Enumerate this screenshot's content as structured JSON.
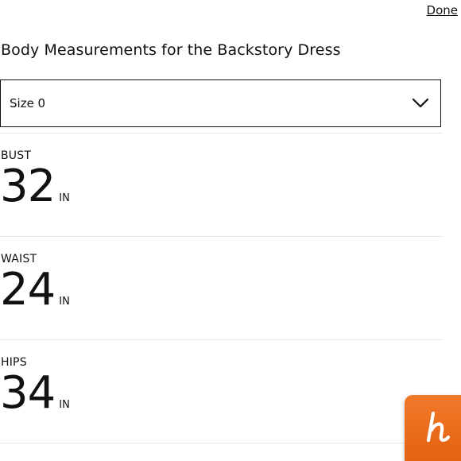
{
  "header": {
    "done_label": "Done",
    "title": "Body Measurements for the Backstory Dress"
  },
  "size_select": {
    "selected": "Size 0",
    "icon": "chevron-down-icon"
  },
  "measurements": [
    {
      "label": "BUST",
      "value": "32",
      "unit": "IN"
    },
    {
      "label": "WAIST",
      "value": "24",
      "unit": "IN"
    },
    {
      "label": "HIPS",
      "value": "34",
      "unit": "IN"
    }
  ],
  "extension_button": {
    "icon": "honey-h-icon",
    "color": "#e8691a"
  }
}
